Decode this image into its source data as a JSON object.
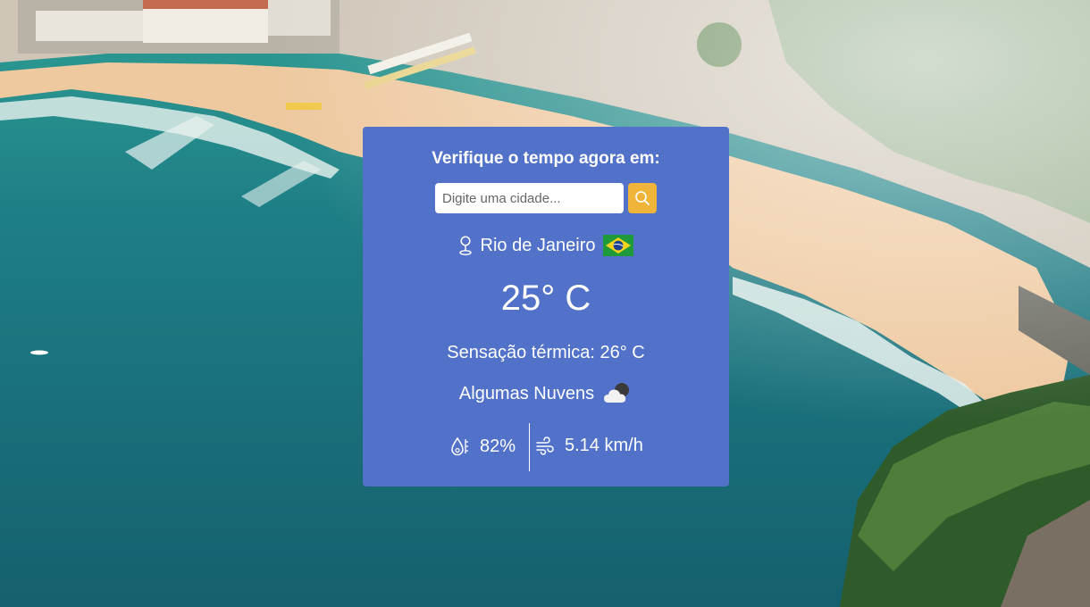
{
  "search": {
    "heading": "Verifique o tempo agora em:",
    "placeholder": "Digite uma cidade...",
    "button_icon": "search-icon"
  },
  "weather": {
    "city": "Rio de Janeiro",
    "country_flag": "brazil-flag-icon",
    "temperature": "25° C",
    "feels_like": "Sensação térmica: 26° C",
    "description": "Algumas Nuvens",
    "description_icon": "partly-cloudy-night-icon",
    "humidity": "82%",
    "wind": "5.14 km/h"
  },
  "colors": {
    "card_background": "#5271c8",
    "search_button": "#f1b43a",
    "text": "#ffffff"
  }
}
